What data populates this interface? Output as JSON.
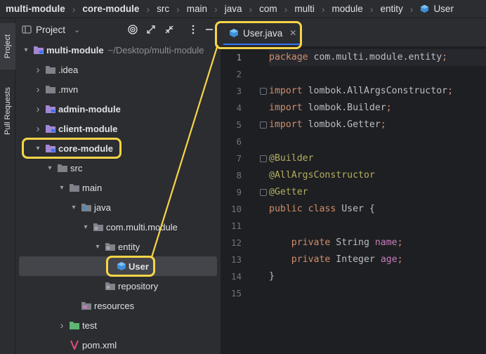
{
  "breadcrumb": [
    {
      "label": "multi-module",
      "bold": true
    },
    {
      "label": "core-module",
      "bold": true
    },
    {
      "label": "src"
    },
    {
      "label": "main"
    },
    {
      "label": "java"
    },
    {
      "label": "com"
    },
    {
      "label": "multi"
    },
    {
      "label": "module"
    },
    {
      "label": "entity"
    },
    {
      "label": "User",
      "icon": "class-icon"
    }
  ],
  "tool_stripe": {
    "project_tab": "Project",
    "pull_requests_tab": "Pull Requests"
  },
  "project_panel": {
    "title": "Project",
    "tree": [
      {
        "label": "multi-module",
        "extra": "~/Desktop/multi-module",
        "indent": 0,
        "arrow": "down",
        "icon": "module-folder-icon",
        "bold": true
      },
      {
        "label": ".idea",
        "indent": 1,
        "arrow": "right",
        "icon": "folder-icon"
      },
      {
        "label": ".mvn",
        "indent": 1,
        "arrow": "right",
        "icon": "folder-icon"
      },
      {
        "label": "admin-module",
        "indent": 1,
        "arrow": "right",
        "icon": "module-folder-icon",
        "bold": true
      },
      {
        "label": "client-module",
        "indent": 1,
        "arrow": "right",
        "icon": "module-folder-icon",
        "bold": true
      },
      {
        "label": "core-module",
        "indent": 1,
        "arrow": "down",
        "icon": "module-folder-icon",
        "bold": true
      },
      {
        "label": "src",
        "indent": 2,
        "arrow": "down",
        "icon": "folder-icon"
      },
      {
        "label": "main",
        "indent": 3,
        "arrow": "down",
        "icon": "folder-icon"
      },
      {
        "label": "java",
        "indent": 4,
        "arrow": "down",
        "icon": "source-folder-icon"
      },
      {
        "label": "com.multi.module",
        "indent": 5,
        "arrow": "down",
        "icon": "package-icon"
      },
      {
        "label": "entity",
        "indent": 6,
        "arrow": "down",
        "icon": "package-icon"
      },
      {
        "label": "User",
        "indent": 7,
        "arrow": "",
        "icon": "class-icon",
        "bold": true,
        "selected": true
      },
      {
        "label": "repository",
        "indent": 6,
        "arrow": "",
        "icon": "package-icon"
      },
      {
        "label": "resources",
        "indent": 4,
        "arrow": "",
        "icon": "resources-folder-icon"
      },
      {
        "label": "test",
        "indent": 3,
        "arrow": "right",
        "icon": "test-folder-icon"
      },
      {
        "label": "pom.xml",
        "indent": 3,
        "arrow": "",
        "icon": "maven-icon"
      }
    ]
  },
  "editor": {
    "tab_label": "User.java",
    "lines": [
      {
        "n": "1",
        "segs": [
          [
            "kw",
            "package "
          ],
          [
            "",
            "com.multi.module.entity"
          ],
          [
            "kw",
            ";"
          ]
        ]
      },
      {
        "n": "2",
        "segs": []
      },
      {
        "n": "3",
        "fold": true,
        "segs": [
          [
            "kw",
            "import "
          ],
          [
            "",
            "lombok."
          ],
          [
            "",
            "AllArgsConstructor"
          ],
          [
            "kw",
            ";"
          ]
        ]
      },
      {
        "n": "4",
        "segs": [
          [
            "kw",
            "import "
          ],
          [
            "",
            "lombok."
          ],
          [
            "",
            "Builder"
          ],
          [
            "kw",
            ";"
          ]
        ]
      },
      {
        "n": "5",
        "fold": true,
        "segs": [
          [
            "kw",
            "import "
          ],
          [
            "",
            "lombok."
          ],
          [
            "",
            "Getter"
          ],
          [
            "kw",
            ";"
          ]
        ]
      },
      {
        "n": "6",
        "segs": []
      },
      {
        "n": "7",
        "fold": true,
        "segs": [
          [
            "ann",
            "@Builder"
          ]
        ]
      },
      {
        "n": "8",
        "segs": [
          [
            "ann",
            "@AllArgsConstructor"
          ]
        ]
      },
      {
        "n": "9",
        "fold": true,
        "segs": [
          [
            "ann",
            "@Getter"
          ]
        ]
      },
      {
        "n": "10",
        "segs": [
          [
            "kw",
            "public class "
          ],
          [
            "",
            "User {"
          ]
        ]
      },
      {
        "n": "11",
        "segs": []
      },
      {
        "n": "12",
        "segs": [
          [
            "kw",
            "    private "
          ],
          [
            "",
            "String "
          ],
          [
            "fld",
            "name"
          ],
          [
            "kw",
            ";"
          ]
        ]
      },
      {
        "n": "13",
        "segs": [
          [
            "kw",
            "    private "
          ],
          [
            "",
            "Integer "
          ],
          [
            "fld",
            "age"
          ],
          [
            "kw",
            ";"
          ]
        ]
      },
      {
        "n": "14",
        "segs": [
          [
            "",
            "}"
          ]
        ]
      },
      {
        "n": "15",
        "segs": []
      }
    ]
  },
  "colors": {
    "highlight": "#f8d448",
    "accent": "#3574f0"
  }
}
